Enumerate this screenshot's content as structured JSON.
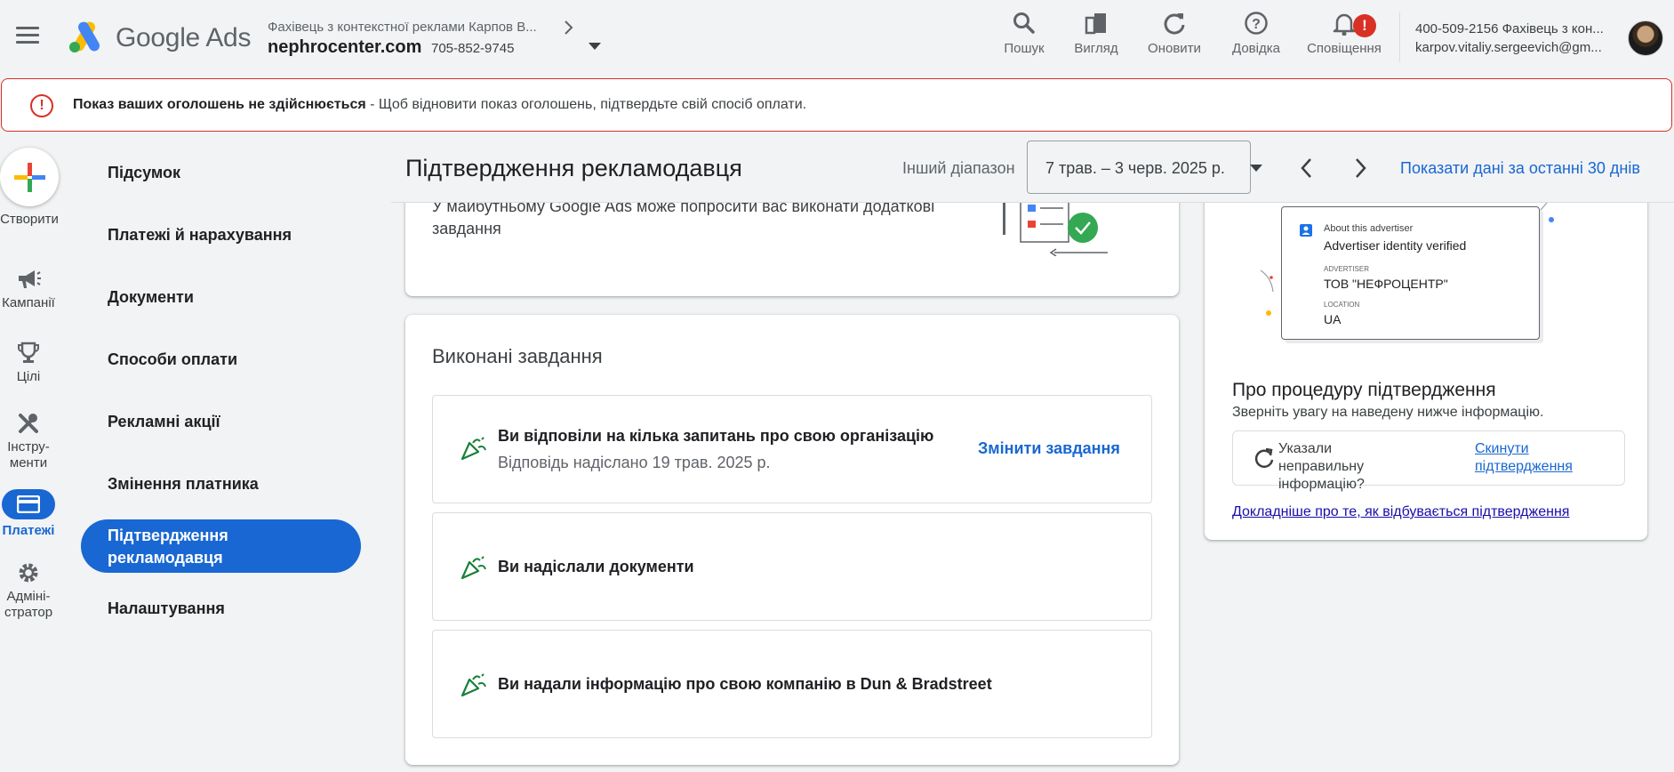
{
  "header": {
    "brand_google": "Google",
    "brand_ads": "Ads",
    "account_path": "Фахівець з контекстної реклами Карпов В...",
    "account_domain": "nephrocenter.com",
    "account_id": "705-852-9745",
    "tools": [
      {
        "label": "Пошук",
        "icon": "search-icon"
      },
      {
        "label": "Вигляд",
        "icon": "appearance-icon"
      },
      {
        "label": "Оновити",
        "icon": "refresh-icon"
      },
      {
        "label": "Довідка",
        "icon": "help-icon"
      },
      {
        "label": "Сповіщення",
        "icon": "bell-icon",
        "badge": "!"
      }
    ],
    "user_line1": "400-509-2156 Фахівець з кон...",
    "user_line2": "karpov.vitaliy.sergeevich@gm..."
  },
  "alert": {
    "bold": "Показ ваших оголошень не здійснюється",
    "text": " - Щоб відновити показ оголошень, підтвердьте свій спосіб оплати.",
    "color": "#d93025"
  },
  "rail": {
    "create": "Створити",
    "items": [
      {
        "label": "Кампанії",
        "icon": "megaphone-icon"
      },
      {
        "label": "Цілі",
        "icon": "trophy-icon"
      },
      {
        "label": "Інстру-\nменти",
        "icon": "tools-icon"
      },
      {
        "label": "Платежі",
        "icon": "credit-card-icon",
        "active": true
      },
      {
        "label": "Адміні-\nстратор",
        "icon": "gear-icon"
      }
    ]
  },
  "nav": {
    "items": [
      "Підсумок",
      "Платежі й нарахування",
      "Документи",
      "Способи оплати",
      "Рекламні акції",
      "Змінення платника"
    ],
    "active": "Підтвердження рекламодавця",
    "after": "Налаштування"
  },
  "page": {
    "title": "Підтвердження рекламодавця",
    "range_label": "Інший діапазон",
    "date_range": "7 трав. – 3 черв. 2025 р.",
    "show_30": "Показати дані за останні 30 днів"
  },
  "top_card": {
    "text": "У майбутньому Google Ads може попросити вас виконати додаткові завдання"
  },
  "done": {
    "title": "Виконані завдання",
    "tasks": [
      {
        "title": "Ви відповіли на кілька запитань про свою організацію",
        "sub": "Відповідь надіслано 19 трав. 2025 р.",
        "link": "Змінити завдання"
      },
      {
        "title": "Ви надіслали документи"
      },
      {
        "title": "Ви надали інформацію про свою компанію в Dun & Bradstreet"
      }
    ]
  },
  "right": {
    "illus": {
      "about": "About this advertiser",
      "verified": "Advertiser identity verified",
      "adv_label": "ADVERTISER",
      "adv_value": "ТОВ \"НЕФРОЦЕНТР\"",
      "loc_label": "LOCATION",
      "loc_value": "UA"
    },
    "about_title": "Про процедуру підтвердження",
    "about_sub": "Зверніть увагу на наведену нижче інформацію.",
    "reset_q": "Указали неправильну інформацію?",
    "reset_link": "Скинути підтвердження",
    "learn_link": "Докладніше про те, як відбувається підтвердження"
  },
  "colors": {
    "accent": "#1967d2",
    "error": "#d93025",
    "task_icon": "#188038"
  }
}
